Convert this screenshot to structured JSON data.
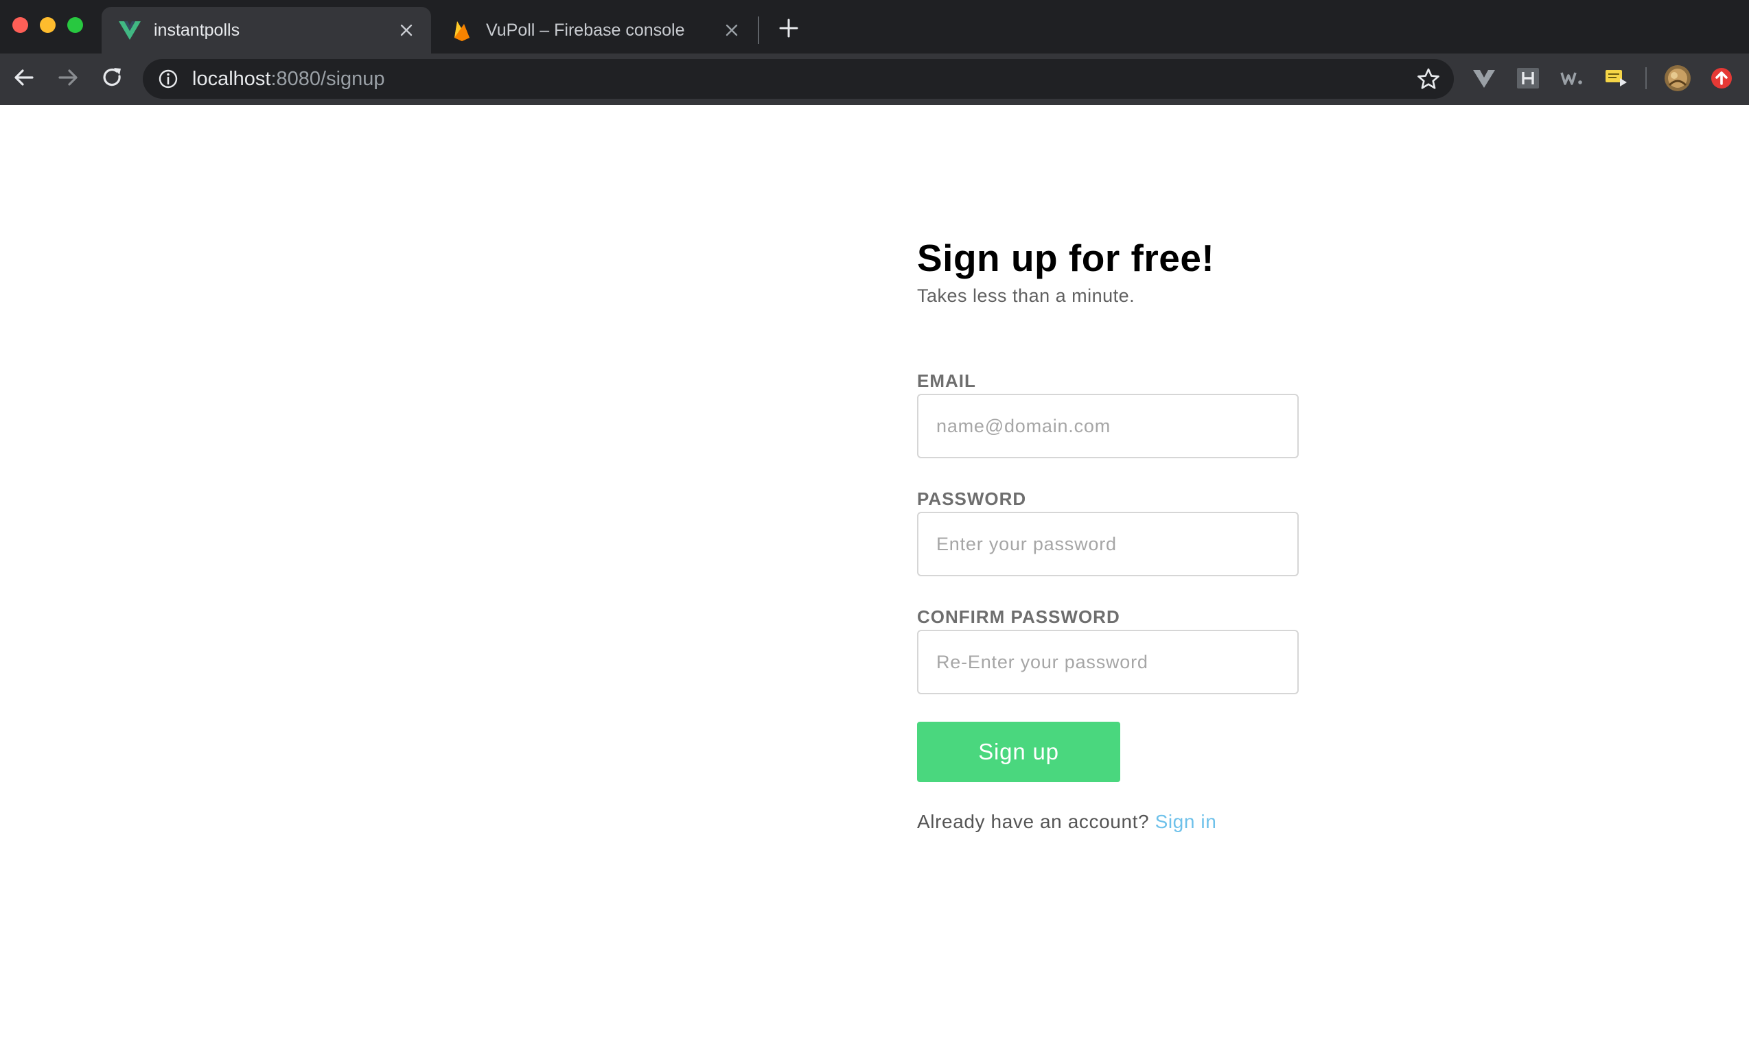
{
  "browser": {
    "tabs": [
      {
        "title": "instantpolls",
        "active": true,
        "favicon": "vue-logo-icon"
      },
      {
        "title": "VuPoll – Firebase console",
        "active": false,
        "favicon": "firebase-flame-icon"
      }
    ],
    "url": {
      "host": "localhost",
      "rest": ":8080/signup"
    },
    "extensions": [
      "vue-devtools-icon",
      "h-extension-icon",
      "w-extension-icon",
      "notes-extension-icon",
      "profile-avatar",
      "update-badge-icon"
    ]
  },
  "page": {
    "heading": "Sign up for free!",
    "subheading": "Takes less than a minute.",
    "email": {
      "label": "EMAIL",
      "placeholder": "name@domain.com",
      "value": ""
    },
    "password": {
      "label": "PASSWORD",
      "placeholder": "Enter your password",
      "value": ""
    },
    "confirm_password": {
      "label": "CONFIRM PASSWORD",
      "placeholder": "Re-Enter your password",
      "value": ""
    },
    "submit_label": "Sign up",
    "footer_text": "Already have an account?",
    "signin_link": "Sign in"
  },
  "colors": {
    "accent_green": "#4ad77e",
    "link_blue": "#6ec1ea",
    "chrome_dark": "#1f2023",
    "chrome_toolbar": "#35363a"
  }
}
